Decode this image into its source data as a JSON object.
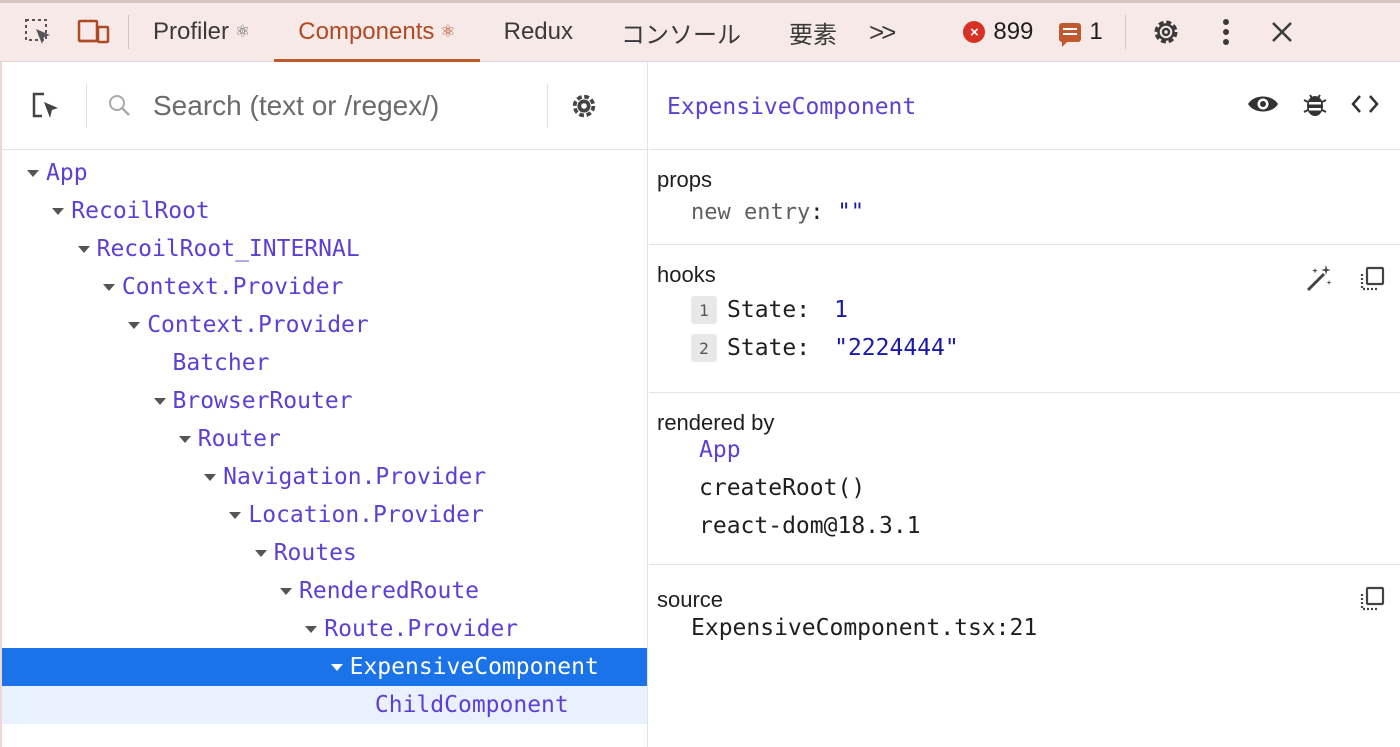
{
  "toolbar": {
    "inspect_icon": "select-element-icon",
    "device_icon": "device-toggle-icon",
    "tabs": [
      {
        "label": "Profiler",
        "badge": "⚛",
        "active": false
      },
      {
        "label": "Components",
        "badge": "⚛",
        "active": true
      },
      {
        "label": "Redux",
        "badge": "",
        "active": false
      },
      {
        "label": "コンソール",
        "badge": "",
        "active": false
      },
      {
        "label": "要素",
        "badge": "",
        "active": false
      }
    ],
    "more_tabs": ">>",
    "error_count": "899",
    "error_icon": "×",
    "message_count": "1",
    "settings_icon": "gear-icon",
    "menu_icon": "kebab-icon",
    "close_icon": "×"
  },
  "left": {
    "search": {
      "placeholder": "Search (text or /regex/)",
      "value": ""
    },
    "tree": [
      {
        "name": "App",
        "depth": 0,
        "expandable": true
      },
      {
        "name": "RecoilRoot",
        "depth": 1,
        "expandable": true
      },
      {
        "name": "RecoilRoot_INTERNAL",
        "depth": 2,
        "expandable": true
      },
      {
        "name": "Context.Provider",
        "depth": 3,
        "expandable": true
      },
      {
        "name": "Context.Provider",
        "depth": 4,
        "expandable": true
      },
      {
        "name": "Batcher",
        "depth": 5,
        "expandable": false
      },
      {
        "name": "BrowserRouter",
        "depth": 5,
        "expandable": true
      },
      {
        "name": "Router",
        "depth": 6,
        "expandable": true
      },
      {
        "name": "Navigation.Provider",
        "depth": 7,
        "expandable": true
      },
      {
        "name": "Location.Provider",
        "depth": 8,
        "expandable": true
      },
      {
        "name": "Routes",
        "depth": 9,
        "expandable": true
      },
      {
        "name": "RenderedRoute",
        "depth": 10,
        "expandable": true
      },
      {
        "name": "Route.Provider",
        "depth": 11,
        "expandable": true
      },
      {
        "name": "ExpensiveComponent",
        "depth": 12,
        "expandable": true,
        "selected": true
      },
      {
        "name": "ChildComponent",
        "depth": 13,
        "expandable": false,
        "highlighted": true
      }
    ]
  },
  "right": {
    "component_name": "ExpensiveComponent",
    "props": {
      "title": "props",
      "items": [
        {
          "key": "new entry",
          "value": "\"\""
        }
      ]
    },
    "hooks": {
      "title": "hooks",
      "items": [
        {
          "index": "1",
          "key": "State:",
          "value": "1"
        },
        {
          "index": "2",
          "key": "State:",
          "value": "\"2224444\""
        }
      ]
    },
    "rendered_by": {
      "title": "rendered by",
      "items": [
        "App",
        "createRoot()",
        "react-dom@18.3.1"
      ]
    },
    "source": {
      "title": "source",
      "file": "ExpensiveComponent.tsx:21"
    }
  },
  "colors": {
    "toolbar_bg": "#f6e9e7",
    "active_tab": "#b04a23",
    "component_purple": "#5d3fd3",
    "selection_blue": "#1a73e8",
    "value_blue": "#1a1aa6",
    "error_red": "#d93025"
  }
}
